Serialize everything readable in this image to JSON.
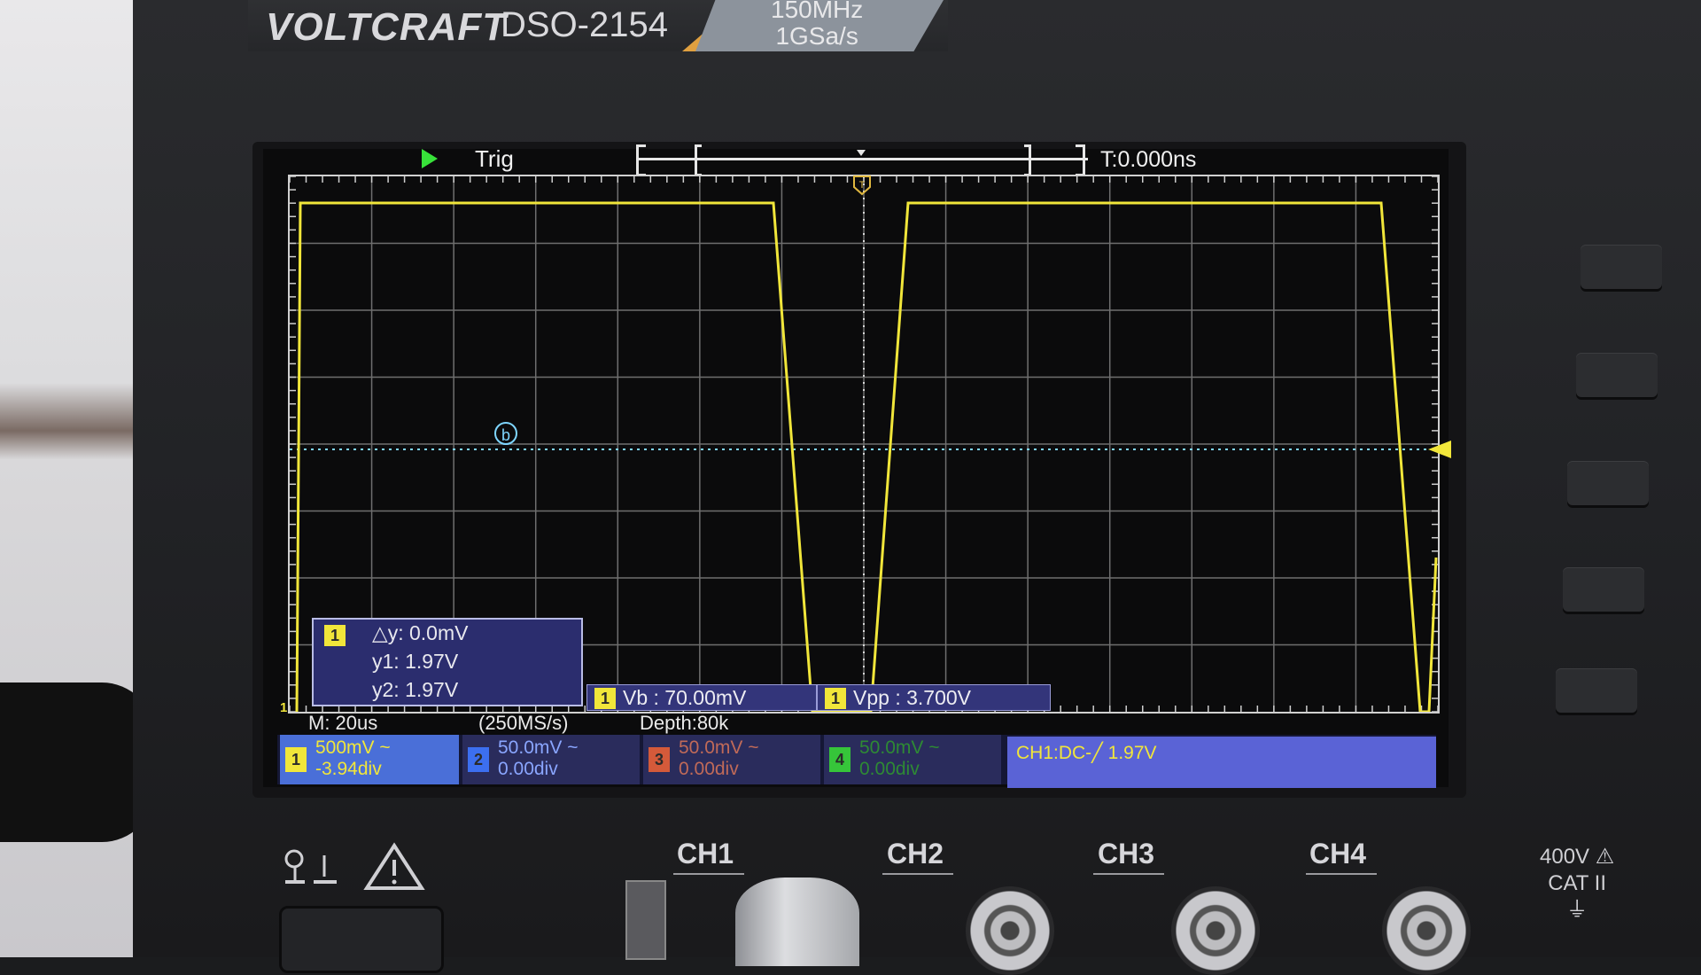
{
  "device": {
    "brand": "VOLTCRAFT",
    "model": "DSO-2154",
    "spec_bandwidth": "150MHz",
    "spec_samplerate": "1GSa/s"
  },
  "status": {
    "run_state_icon": "play-icon",
    "trigger_status": "Trig",
    "trigger_time": "T:0.000ns"
  },
  "cursor_readout": {
    "channel": "1",
    "delta_y": "△y: 0.0mV",
    "y1": "y1: 1.97V",
    "y2": "y2: 1.97V",
    "cursor_label": "b"
  },
  "ground_marker": "1",
  "measurements": [
    {
      "channel": "1",
      "text": "Vb : 70.00mV"
    },
    {
      "channel": "1",
      "text": "Vpp : 3.700V"
    }
  ],
  "timebase": {
    "main": "M: 20us",
    "sample_rate": "(250MS/s)",
    "depth": "Depth:80k"
  },
  "channels": [
    {
      "id": "1",
      "scale": "500mV ~",
      "offset": "-3.94div",
      "color": "#f1e63a"
    },
    {
      "id": "2",
      "scale": "50.0mV ~",
      "offset": "0.00div",
      "color": "#3c6ff0"
    },
    {
      "id": "3",
      "scale": "50.0mV ~",
      "offset": "0.00div",
      "color": "#d45a3a"
    },
    {
      "id": "4",
      "scale": "50.0mV ~",
      "offset": "0.00div",
      "color": "#36c53a"
    }
  ],
  "trigger_setting": "CH1:DC-╱ 1.97V",
  "front_panel": {
    "inputs": [
      "CH1",
      "CH2",
      "CH3",
      "CH4"
    ],
    "rating_voltage": "400V",
    "rating_cat": "CAT II"
  },
  "colors": {
    "trace": "#f1e63a",
    "grid": "#6f6f6f",
    "cursor_line": "#7fd6ff"
  }
}
